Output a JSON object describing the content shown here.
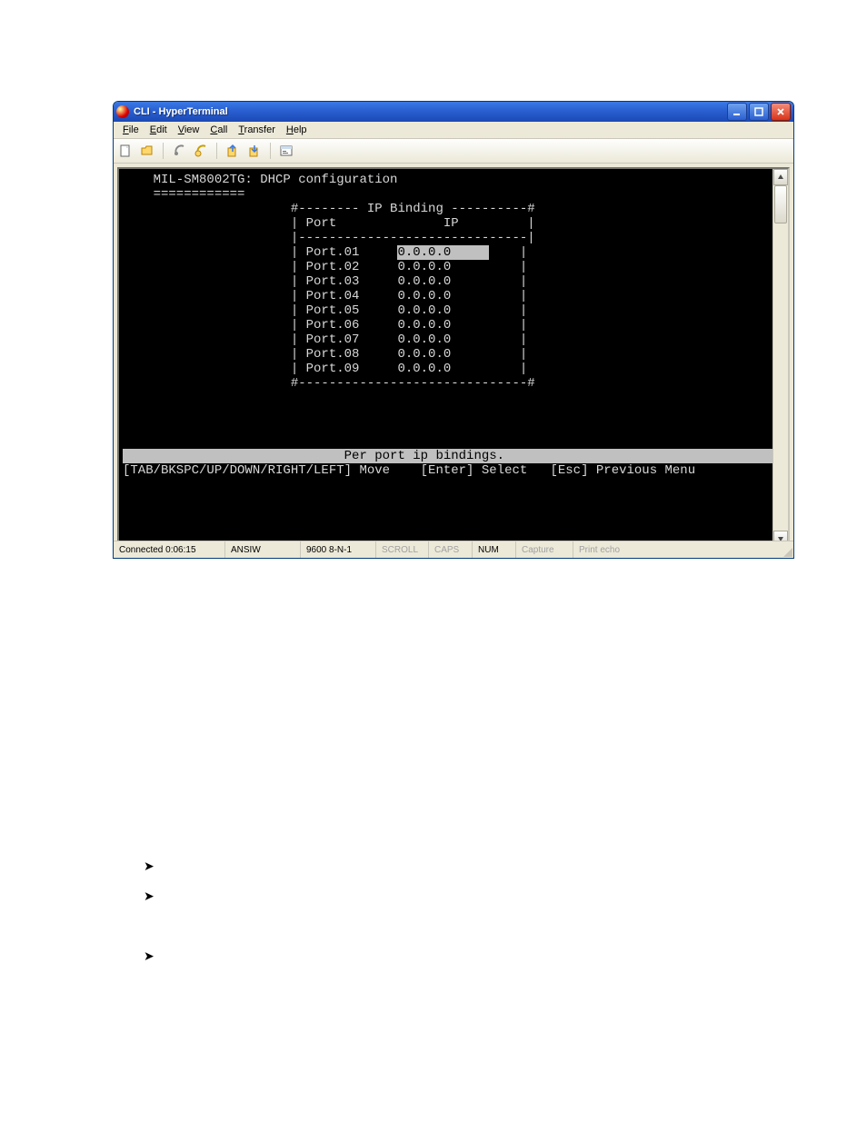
{
  "window": {
    "title": "CLI - HyperTerminal"
  },
  "menu": {
    "file": "File",
    "edit": "Edit",
    "view": "View",
    "call": "Call",
    "transfer": "Transfer",
    "help": "Help"
  },
  "terminal": {
    "header": "MIL-SM8002TG: DHCP configuration",
    "underline": "============",
    "box_top": "#-------- IP Binding ----------#",
    "col_header": "| Port              IP         |",
    "box_sep": "|------------------------------|",
    "rows": [
      {
        "port": "Port.01",
        "ip": "0.0.0.0",
        "selected": true
      },
      {
        "port": "Port.02",
        "ip": "0.0.0.0",
        "selected": false
      },
      {
        "port": "Port.03",
        "ip": "0.0.0.0",
        "selected": false
      },
      {
        "port": "Port.04",
        "ip": "0.0.0.0",
        "selected": false
      },
      {
        "port": "Port.05",
        "ip": "0.0.0.0",
        "selected": false
      },
      {
        "port": "Port.06",
        "ip": "0.0.0.0",
        "selected": false
      },
      {
        "port": "Port.07",
        "ip": "0.0.0.0",
        "selected": false
      },
      {
        "port": "Port.08",
        "ip": "0.0.0.0",
        "selected": false
      },
      {
        "port": "Port.09",
        "ip": "0.0.0.0",
        "selected": false
      }
    ],
    "box_bot": "#------------------------------#",
    "hint": "Per port ip bindings.",
    "nav": "[TAB/BKSPC/UP/DOWN/RIGHT/LEFT] Move    [Enter] Select   [Esc] Previous Menu"
  },
  "status": {
    "connected": "Connected 0:06:15",
    "emu": "ANSIW",
    "settings": "9600 8-N-1",
    "scroll": "SCROLL",
    "caps": "CAPS",
    "num": "NUM",
    "capture": "Capture",
    "printecho": "Print echo"
  }
}
